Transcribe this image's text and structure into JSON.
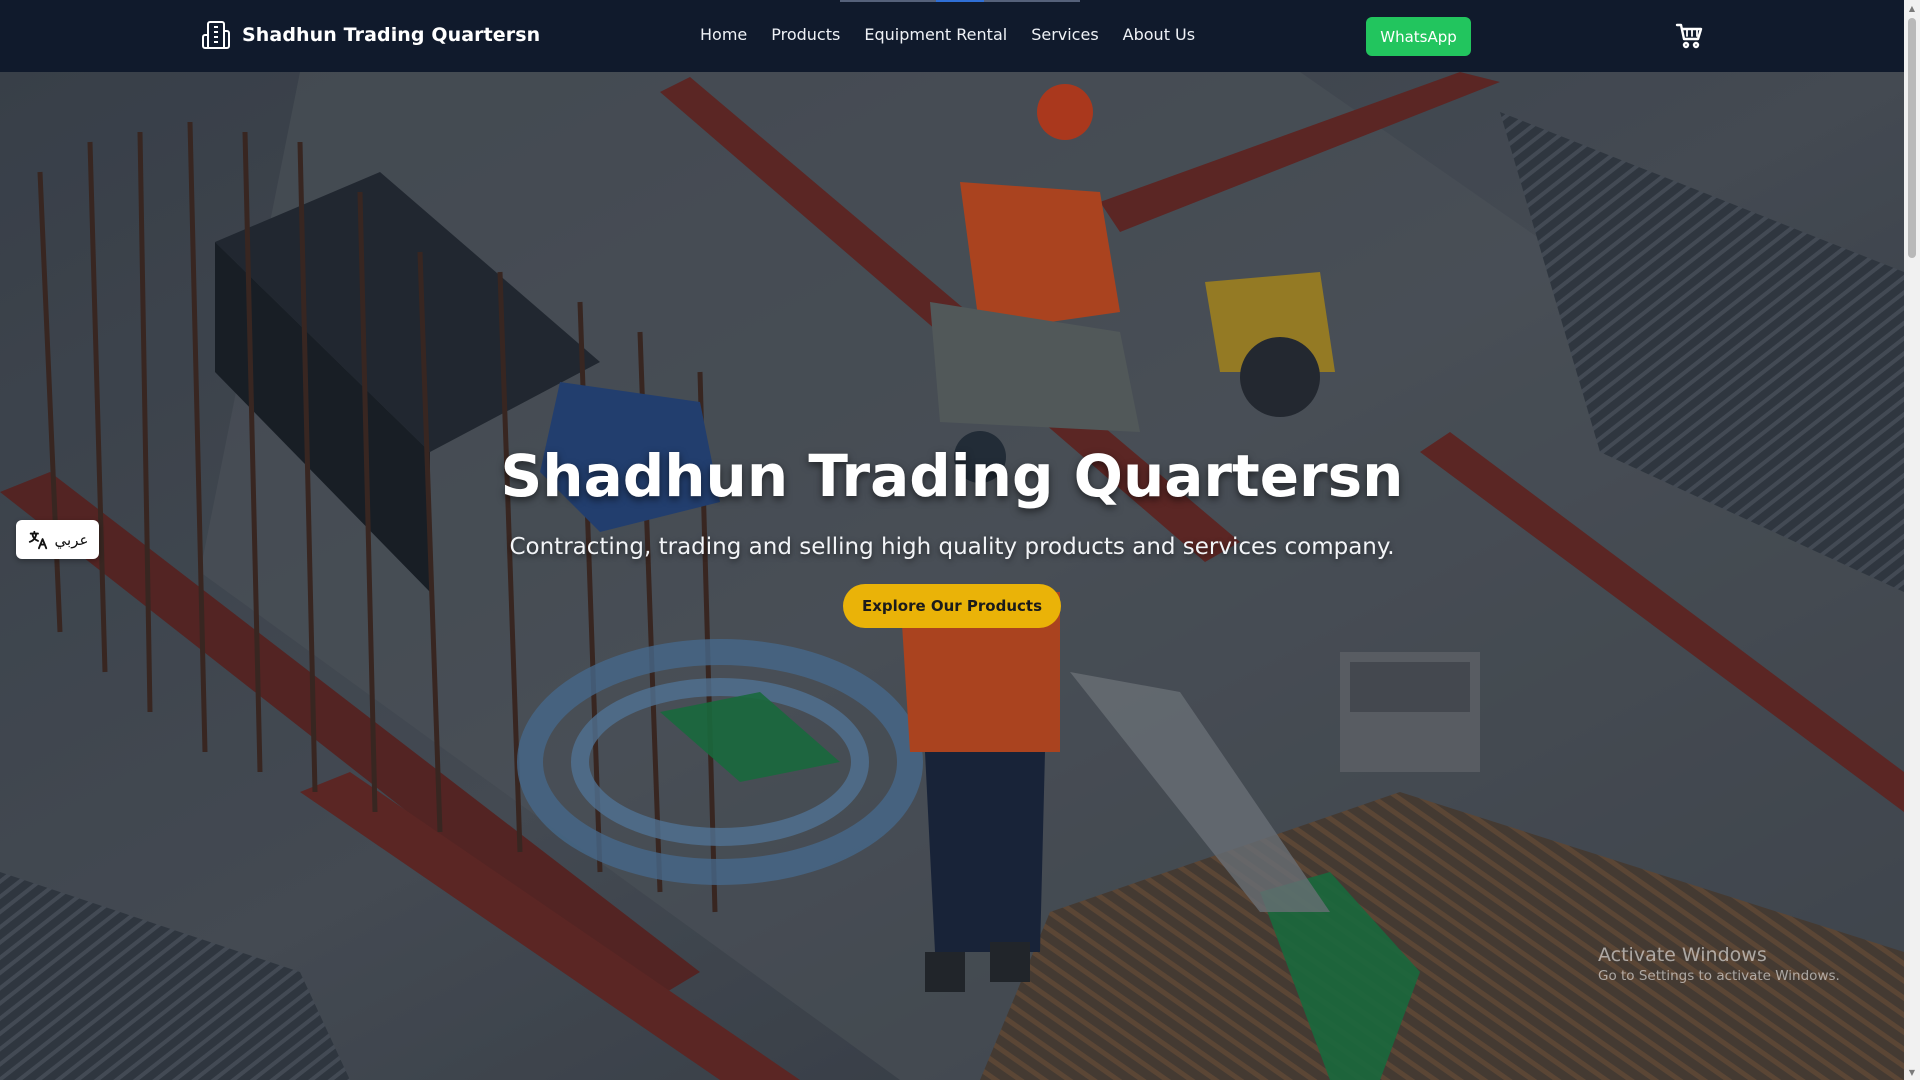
{
  "navbar": {
    "brand_name": "Shadhun Trading Quartersn",
    "brand_icon": "building-icon",
    "links": [
      "Home",
      "Products",
      "Equipment Rental",
      "Services",
      "About Us"
    ],
    "whatsapp_label": "WhatsApp",
    "cart_icon": "cart-icon"
  },
  "hero": {
    "title": "Shadhun Trading Quartersn",
    "subtitle": "Contracting, trading and selling high quality products and services company.",
    "cta_label": "Explore Our Products",
    "background": "construction-site-photo"
  },
  "language_toggle": {
    "label": "عربي",
    "icon": "translate-icon"
  },
  "watermark": {
    "title": "Activate Windows",
    "subtitle": "Go to Settings to activate Windows."
  },
  "colors": {
    "navbar_bg": "#101a2c",
    "whatsapp_green": "#22c55e",
    "cta_yellow": "#eab308",
    "hero_text": "#ffffff"
  }
}
